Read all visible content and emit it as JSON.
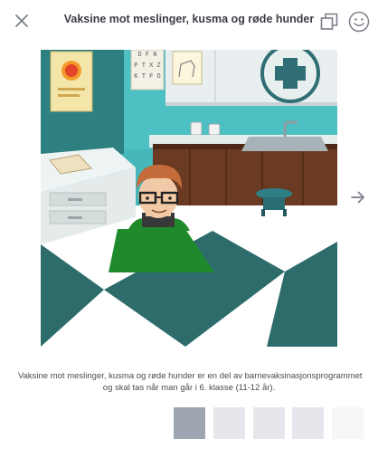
{
  "header": {
    "title": "Vaksine mot meslinger, kusma og røde hunder"
  },
  "illustration": {
    "eye_chart_lines": [
      "D F N",
      "P T X Z",
      "K T F O"
    ]
  },
  "caption": {
    "line1": "Vaksine mot meslinger, kusma og røde hunder er en del av barnevaksinasjonsprogrammet",
    "line2": "og skal tas når man går i 6. klasse (11-12 år)."
  },
  "progress": {
    "steps": 5,
    "current": 1
  },
  "colors": {
    "active_step": "#9ea6b2",
    "inactive_step": "#e6e7ec",
    "far_step": "#f6f6f8",
    "floor_dark": "#2d6c6b",
    "wall": "#3aaeb3",
    "shirt": "#1f8a2c"
  }
}
